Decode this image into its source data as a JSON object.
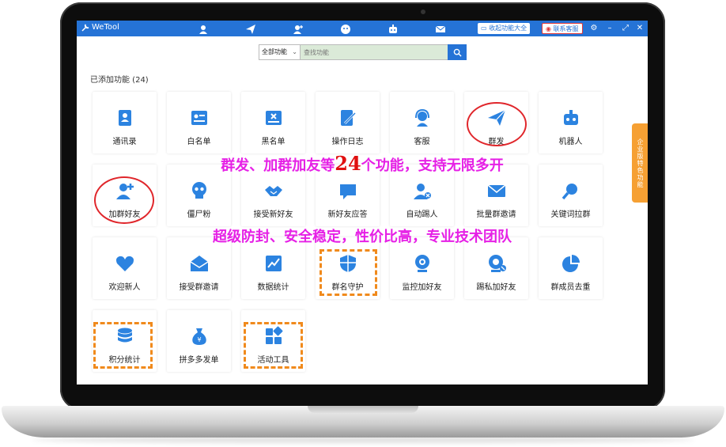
{
  "app": {
    "name": "WeTool"
  },
  "titlebar": {
    "icons": [
      "contacts-icon",
      "send-icon",
      "user-add-icon",
      "robot-face-icon",
      "robot-icon",
      "mail-icon"
    ],
    "collapse_label": "收起功能大全",
    "contact_label": "联系客服"
  },
  "search": {
    "category": "全部功能",
    "placeholder": "查找功能"
  },
  "section": {
    "title": "已添加功能 (24)"
  },
  "features": [
    {
      "label": "通讯录",
      "icon": "address-book-icon"
    },
    {
      "label": "白名单",
      "icon": "whitelist-icon"
    },
    {
      "label": "黑名单",
      "icon": "blacklist-icon"
    },
    {
      "label": "操作日志",
      "icon": "log-edit-icon"
    },
    {
      "label": "客服",
      "icon": "headset-icon"
    },
    {
      "label": "群发",
      "icon": "paper-plane-icon"
    },
    {
      "label": "机器人",
      "icon": "robot-icon"
    },
    {
      "label": "加群好友",
      "icon": "add-friend-icon"
    },
    {
      "label": "僵尸粉",
      "icon": "skull-icon"
    },
    {
      "label": "接受新好友",
      "icon": "handshake-icon"
    },
    {
      "label": "新好友应答",
      "icon": "chat-bubble-icon"
    },
    {
      "label": "自动踢人",
      "icon": "kick-user-icon"
    },
    {
      "label": "批量群邀请",
      "icon": "envelope-icon"
    },
    {
      "label": "关键词拉群",
      "icon": "search-keyword-icon"
    },
    {
      "label": "欢迎新人",
      "icon": "heart-icon"
    },
    {
      "label": "接受群邀请",
      "icon": "open-mail-icon"
    },
    {
      "label": "数据统计",
      "icon": "line-chart-icon"
    },
    {
      "label": "群名守护",
      "icon": "shield-icon"
    },
    {
      "label": "监控加好友",
      "icon": "webcam-icon"
    },
    {
      "label": "踢私加好友",
      "icon": "webcam-kick-icon"
    },
    {
      "label": "群成员去重",
      "icon": "pie-chart-icon"
    },
    {
      "label": "积分统计",
      "icon": "database-icon"
    },
    {
      "label": "拼多多发单",
      "icon": "money-bag-icon"
    },
    {
      "label": "活动工具",
      "icon": "tools-grid-icon"
    }
  ],
  "side_tab": {
    "label": "企业版特色功能"
  },
  "promo": {
    "line1_before": "群发、加群加友等",
    "line1_number": "24",
    "line1_after": "个功能，支持无限多开",
    "line2": "超级防封、安全稳定，性价比高，专业技术团队"
  },
  "colors": {
    "titlebar": "#2573d6",
    "icon_blue": "#2c83e0",
    "promo": "#e620e6",
    "circle": "#e0262b",
    "dashed": "#f08a1c",
    "side_tab": "#f6a033"
  }
}
